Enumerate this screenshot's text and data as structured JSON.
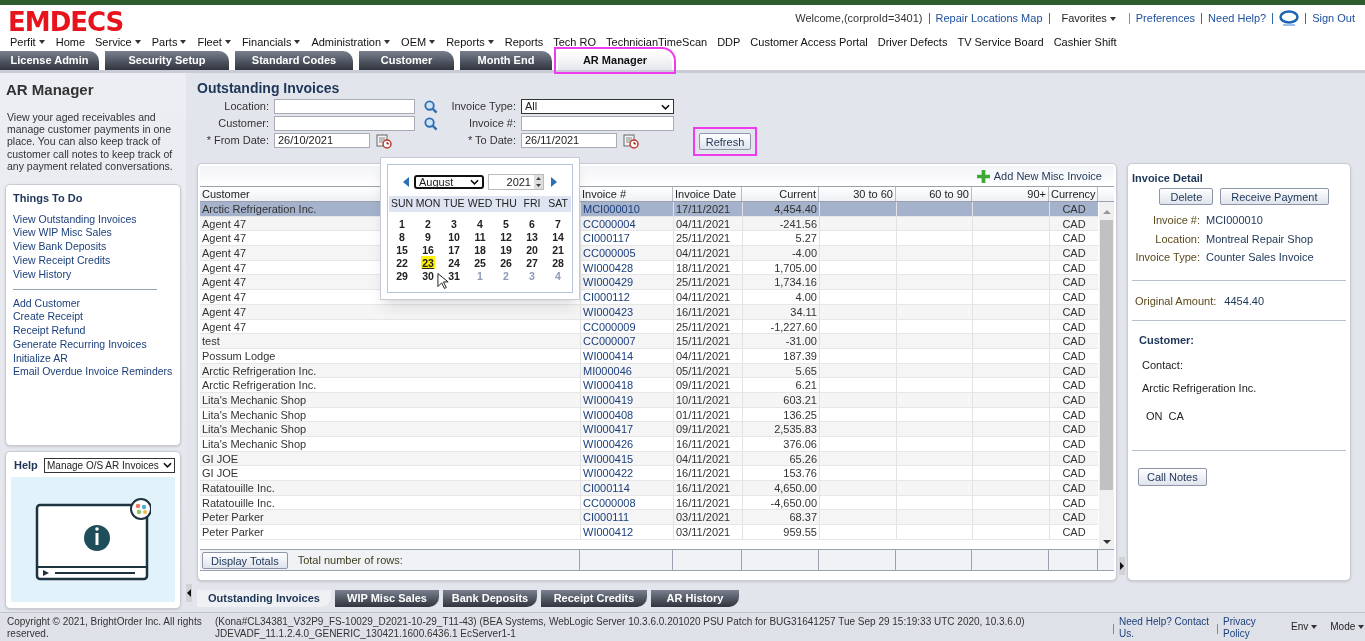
{
  "logo": "EMDECS",
  "top_links": [
    {
      "text": "Welcome,(corproId=3401)",
      "kind": "text"
    },
    {
      "text": "Repair Locations Map",
      "kind": "link"
    },
    {
      "text": "Favorites",
      "kind": "dropdown"
    },
    {
      "text": "Preferences",
      "kind": "link"
    },
    {
      "text": "Need Help?",
      "kind": "link"
    },
    {
      "kind": "help_icon"
    },
    {
      "text": "Sign Out",
      "kind": "link"
    }
  ],
  "menu": [
    {
      "label": "Perfit",
      "dropdown": true
    },
    {
      "label": "Home",
      "dropdown": false
    },
    {
      "label": "Service",
      "dropdown": true
    },
    {
      "label": "Parts",
      "dropdown": true
    },
    {
      "label": "Fleet",
      "dropdown": true
    },
    {
      "label": "Financials",
      "dropdown": true
    },
    {
      "label": "Administration",
      "dropdown": true
    },
    {
      "label": "OEM",
      "dropdown": true
    },
    {
      "label": "Reports",
      "dropdown": true
    },
    {
      "label": "Reports",
      "dropdown": false
    },
    {
      "label": "Tech RO",
      "dropdown": false
    },
    {
      "label": "TechnicianTimeScan",
      "dropdown": false
    },
    {
      "label": "DDP",
      "dropdown": false
    },
    {
      "label": "Customer Access Portal",
      "dropdown": false
    },
    {
      "label": "Driver Defects",
      "dropdown": false
    },
    {
      "label": "TV Service Board",
      "dropdown": false
    },
    {
      "label": "Cashier Shift",
      "dropdown": false
    }
  ],
  "tabs": [
    {
      "label": "License Admin",
      "selected": false,
      "highlighted": false
    },
    {
      "label": "Security Setup",
      "selected": false,
      "highlighted": false
    },
    {
      "label": "Standard Codes",
      "selected": false,
      "highlighted": false
    },
    {
      "label": "Customer",
      "selected": false,
      "highlighted": false
    },
    {
      "label": "Month End",
      "selected": false,
      "highlighted": false
    },
    {
      "label": "AR Manager",
      "selected": true,
      "highlighted": true
    }
  ],
  "sidebar": {
    "title": "AR Manager",
    "description": "View your aged receivables and manage customer payments in one place. You can also keep track of customer call notes to keep track of any payment related conversations.",
    "things_to_do": {
      "title": "Things To Do",
      "groups": [
        {
          "items": [
            "View Outstanding Invoices",
            "View WIP Misc Sales",
            "View Bank Deposits",
            "View Receipt Credits",
            "View History"
          ]
        },
        {
          "items": [
            "Add Customer",
            "Create Receipt",
            "Receipt Refund",
            "Generate Recurring Invoices",
            "Initialize AR",
            "Email Overdue Invoice Reminders"
          ]
        }
      ]
    },
    "help": {
      "title": "Help",
      "topic": "Manage O/S AR Invoices"
    }
  },
  "search": {
    "title": "Outstanding Invoices",
    "location": {
      "label": "Location:"
    },
    "customer": {
      "label": "Customer:"
    },
    "from_date": {
      "label": "* From Date:",
      "value": "26/10/2021"
    },
    "invoice_type": {
      "label": "Invoice Type:",
      "value": "All"
    },
    "invoice_no": {
      "label": "Invoice #:"
    },
    "to_date": {
      "label": "* To Date:",
      "value": "26/11/2021"
    },
    "refresh": {
      "label": "Refresh",
      "highlighted": true
    }
  },
  "calendar": {
    "month": "August",
    "year": "2021",
    "weekdays": [
      "SUN",
      "MON",
      "TUE",
      "WED",
      "THU",
      "FRI",
      "SAT"
    ],
    "days": [
      {
        "label": "1",
        "other_month": false,
        "selected": false
      },
      {
        "label": "2",
        "other_month": false,
        "selected": false
      },
      {
        "label": "3",
        "other_month": false,
        "selected": false
      },
      {
        "label": "4",
        "other_month": false,
        "selected": false
      },
      {
        "label": "5",
        "other_month": false,
        "selected": false
      },
      {
        "label": "6",
        "other_month": false,
        "selected": false
      },
      {
        "label": "7",
        "other_month": false,
        "selected": false
      },
      {
        "label": "8",
        "other_month": false,
        "selected": false
      },
      {
        "label": "9",
        "other_month": false,
        "selected": false
      },
      {
        "label": "10",
        "other_month": false,
        "selected": false
      },
      {
        "label": "11",
        "other_month": false,
        "selected": false
      },
      {
        "label": "12",
        "other_month": false,
        "selected": false
      },
      {
        "label": "13",
        "other_month": false,
        "selected": false
      },
      {
        "label": "14",
        "other_month": false,
        "selected": false
      },
      {
        "label": "15",
        "other_month": false,
        "selected": false
      },
      {
        "label": "16",
        "other_month": false,
        "selected": false
      },
      {
        "label": "17",
        "other_month": false,
        "selected": false
      },
      {
        "label": "18",
        "other_month": false,
        "selected": false
      },
      {
        "label": "19",
        "other_month": false,
        "selected": false
      },
      {
        "label": "20",
        "other_month": false,
        "selected": false
      },
      {
        "label": "21",
        "other_month": false,
        "selected": false
      },
      {
        "label": "22",
        "other_month": false,
        "selected": false
      },
      {
        "label": "23",
        "other_month": false,
        "selected": true
      },
      {
        "label": "24",
        "other_month": false,
        "selected": false
      },
      {
        "label": "25",
        "other_month": false,
        "selected": false
      },
      {
        "label": "26",
        "other_month": false,
        "selected": false
      },
      {
        "label": "27",
        "other_month": false,
        "selected": false
      },
      {
        "label": "28",
        "other_month": false,
        "selected": false
      },
      {
        "label": "29",
        "other_month": false,
        "selected": false
      },
      {
        "label": "30",
        "other_month": false,
        "selected": false
      },
      {
        "label": "31",
        "other_month": false,
        "selected": false
      },
      {
        "label": "1",
        "other_month": true,
        "selected": false
      },
      {
        "label": "2",
        "other_month": true,
        "selected": false
      },
      {
        "label": "3",
        "other_month": true,
        "selected": false
      },
      {
        "label": "4",
        "other_month": true,
        "selected": false
      }
    ]
  },
  "table": {
    "add_link": "Add New Misc Invoice",
    "columns": [
      "Customer",
      "Invoice #",
      "Invoice Date",
      "Current",
      "30 to 60",
      "60 to 90",
      "90+",
      "Currency"
    ],
    "rows": [
      {
        "customer": "Arctic Refrigeration Inc.",
        "invoice_no": "MCI000010",
        "invoice_date": "17/11/2021",
        "current": "4,454.40",
        "currency": "CAD",
        "selected": true
      },
      {
        "customer": "Agent 47",
        "invoice_no": "CC000004",
        "invoice_date": "04/11/2021",
        "current": "-241.56",
        "currency": "CAD",
        "selected": false
      },
      {
        "customer": "Agent 47",
        "invoice_no": "CI000117",
        "invoice_date": "25/11/2021",
        "current": "5.27",
        "currency": "CAD",
        "selected": false
      },
      {
        "customer": "Agent 47",
        "invoice_no": "CC000005",
        "invoice_date": "04/11/2021",
        "current": "-4.00",
        "currency": "CAD",
        "selected": false
      },
      {
        "customer": "Agent 47",
        "invoice_no": "WI000428",
        "invoice_date": "18/11/2021",
        "current": "1,705.00",
        "currency": "CAD",
        "selected": false
      },
      {
        "customer": "Agent 47",
        "invoice_no": "WI000429",
        "invoice_date": "25/11/2021",
        "current": "1,734.16",
        "currency": "CAD",
        "selected": false
      },
      {
        "customer": "Agent 47",
        "invoice_no": "CI000112",
        "invoice_date": "04/11/2021",
        "current": "4.00",
        "currency": "CAD",
        "selected": false
      },
      {
        "customer": "Agent 47",
        "invoice_no": "WI000423",
        "invoice_date": "16/11/2021",
        "current": "34.11",
        "currency": "CAD",
        "selected": false
      },
      {
        "customer": "Agent 47",
        "invoice_no": "CC000009",
        "invoice_date": "25/11/2021",
        "current": "-1,227.60",
        "currency": "CAD",
        "selected": false
      },
      {
        "customer": "test",
        "invoice_no": "CC000007",
        "invoice_date": "15/11/2021",
        "current": "-31.00",
        "currency": "CAD",
        "selected": false
      },
      {
        "customer": "Possum Lodge",
        "invoice_no": "WI000414",
        "invoice_date": "04/11/2021",
        "current": "187.39",
        "currency": "CAD",
        "selected": false
      },
      {
        "customer": "Arctic Refrigeration Inc.",
        "invoice_no": "MI000046",
        "invoice_date": "05/11/2021",
        "current": "5.65",
        "currency": "CAD",
        "selected": false
      },
      {
        "customer": "Arctic Refrigeration Inc.",
        "invoice_no": "WI000418",
        "invoice_date": "09/11/2021",
        "current": "6.21",
        "currency": "CAD",
        "selected": false
      },
      {
        "customer": "Lita's Mechanic Shop",
        "invoice_no": "WI000419",
        "invoice_date": "10/11/2021",
        "current": "603.21",
        "currency": "CAD",
        "selected": false
      },
      {
        "customer": "Lita's Mechanic Shop",
        "invoice_no": "WI000408",
        "invoice_date": "01/11/2021",
        "current": "136.25",
        "currency": "CAD",
        "selected": false
      },
      {
        "customer": "Lita's Mechanic Shop",
        "invoice_no": "WI000417",
        "invoice_date": "09/11/2021",
        "current": "2,535.83",
        "currency": "CAD",
        "selected": false
      },
      {
        "customer": "Lita's Mechanic Shop",
        "invoice_no": "WI000426",
        "invoice_date": "16/11/2021",
        "current": "376.06",
        "currency": "CAD",
        "selected": false
      },
      {
        "customer": "GI JOE",
        "invoice_no": "WI000415",
        "invoice_date": "04/11/2021",
        "current": "65.26",
        "currency": "CAD",
        "selected": false
      },
      {
        "customer": "GI JOE",
        "invoice_no": "WI000422",
        "invoice_date": "16/11/2021",
        "current": "153.76",
        "currency": "CAD",
        "selected": false
      },
      {
        "customer": "Ratatouille Inc.",
        "invoice_no": "CI000114",
        "invoice_date": "16/11/2021",
        "current": "4,650.00",
        "currency": "CAD",
        "selected": false
      },
      {
        "customer": "Ratatouille Inc.",
        "invoice_no": "CC000008",
        "invoice_date": "16/11/2021",
        "current": "-4,650.00",
        "currency": "CAD",
        "selected": false
      },
      {
        "customer": "Peter Parker",
        "invoice_no": "CI000111",
        "invoice_date": "03/11/2021",
        "current": "68.37",
        "currency": "CAD",
        "selected": false
      },
      {
        "customer": "Peter Parker",
        "invoice_no": "WI000412",
        "invoice_date": "03/11/2021",
        "current": "959.55",
        "currency": "CAD",
        "selected": false
      }
    ],
    "display_totals": "Display Totals",
    "total_rows_label": "Total number of rows:"
  },
  "bottom_tabs": [
    {
      "label": "Outstanding Invoices",
      "selected": true
    },
    {
      "label": "WIP Misc Sales",
      "selected": false
    },
    {
      "label": "Bank Deposits",
      "selected": false
    },
    {
      "label": "Receipt Credits",
      "selected": false
    },
    {
      "label": "AR History",
      "selected": false
    }
  ],
  "invoice_detail": {
    "title": "Invoice Detail",
    "buttons": [
      "Delete",
      "Receive Payment"
    ],
    "fields": [
      {
        "label": "Invoice #:",
        "value": "MCI000010"
      },
      {
        "label": "Location:",
        "value": "Montreal Repair Shop"
      },
      {
        "label": "Invoice Type:",
        "value": "Counter Sales Invoice"
      }
    ],
    "original_amount": {
      "label": "Original Amount:",
      "value": "4454.40"
    },
    "customer_title": "Customer:",
    "contact_label": "Contact:",
    "customer_name": "Arctic Refrigeration Inc.",
    "region": "ON  CA",
    "call_notes": "Call Notes"
  },
  "footer": {
    "copyright": "Copyright © 2021, BrightOrder Inc. All rights reserved.",
    "version_1": "(Kona#CL34381_V32P9_FS-10029_D2021-10-29_T11-43) (BEA Systems, WebLogic Server 10.3.6.0.201020 PSU Patch for BUG31641257 Tue Sep 29 15:19:33 UTC 2020, 10.3.6.0)",
    "version_2": "JDEVADF_11.1.2.4.0_GENERIC_130421.1600.6436.1 EcServer1-1",
    "links": [
      "Need Help? Contact Us.",
      "Privacy Policy"
    ],
    "menus": [
      "Env",
      "Mode"
    ]
  }
}
